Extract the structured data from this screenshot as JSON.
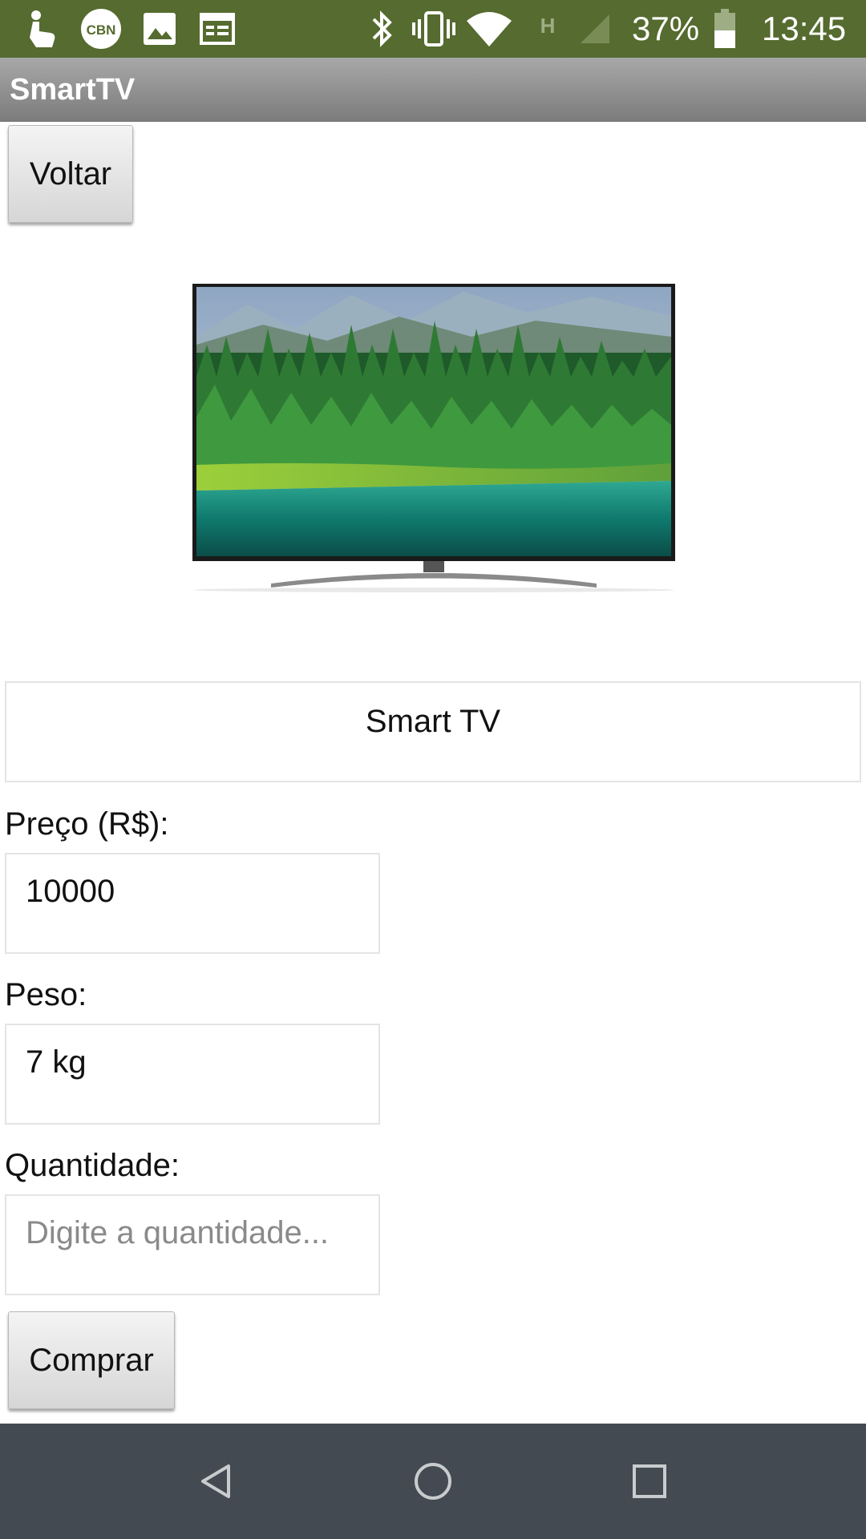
{
  "status_bar": {
    "battery": "37%",
    "time": "13:45",
    "network_letter": "H",
    "badge": "CBN",
    "icons": [
      "hand-icon",
      "cbn-icon",
      "image-icon",
      "calendar-icon",
      "bluetooth-icon",
      "vibrate-icon",
      "wifi-icon",
      "network-h-icon",
      "signal-icon",
      "battery-icon"
    ]
  },
  "app": {
    "title": "SmartTV",
    "back_label": "Voltar"
  },
  "product": {
    "image": "smart-tv-image",
    "name": "Smart TV",
    "price_label": "Preço (R$):",
    "price_value": "10000",
    "weight_label": "Peso:",
    "weight_value": "7 kg",
    "quantity_label": "Quantidade:",
    "quantity_placeholder": "Digite a quantidade...",
    "buy_label": "Comprar"
  },
  "nav_bar": {
    "icons": [
      "back-icon",
      "home-icon",
      "recents-icon"
    ]
  },
  "colors": {
    "status_bar": "#556b2f",
    "title_bar": "#8a8a8a",
    "nav_bar": "#434a51"
  }
}
